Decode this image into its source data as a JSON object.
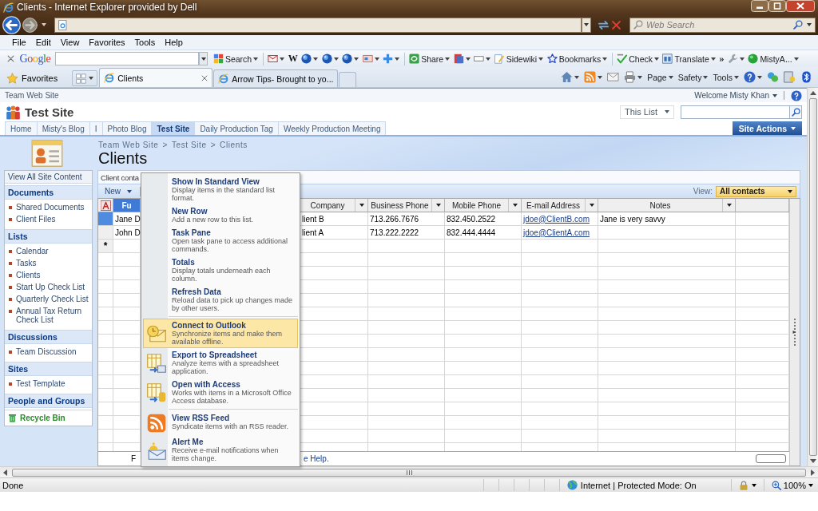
{
  "window": {
    "title": "Clients - Internet Explorer provided by Dell"
  },
  "address_bar": {
    "forward_disabled": true,
    "search_placeholder": "Web Search"
  },
  "menu_bar": [
    "File",
    "Edit",
    "View",
    "Favorites",
    "Tools",
    "Help"
  ],
  "google_toolbar": {
    "logo": "Google",
    "items": [
      {
        "kind": "search",
        "label": "Search",
        "dropdown": true
      },
      {
        "kind": "separator"
      },
      {
        "kind": "mail",
        "dropdown": true
      },
      {
        "kind": "text",
        "label": "W",
        "dropdown": false
      },
      {
        "kind": "globe",
        "dropdown": true
      },
      {
        "kind": "globe",
        "dropdown": true
      },
      {
        "kind": "globe",
        "dropdown": true
      },
      {
        "kind": "card",
        "dropdown": true
      },
      {
        "kind": "plus",
        "dropdown": true
      },
      {
        "kind": "separator"
      },
      {
        "kind": "share",
        "label": "Share",
        "dropdown": true
      },
      {
        "kind": "pdf",
        "dropdown": true
      },
      {
        "kind": "frame",
        "dropdown": true
      },
      {
        "kind": "sidewiki",
        "label": "Sidewiki",
        "dropdown": true
      },
      {
        "kind": "star",
        "label": "Bookmarks",
        "dropdown": true
      },
      {
        "kind": "separator"
      },
      {
        "kind": "spell",
        "label": "Check",
        "dropdown": true
      },
      {
        "kind": "translate",
        "label": "Translate",
        "dropdown": true
      },
      {
        "kind": "text",
        "label": "»",
        "dropdown": false
      },
      {
        "kind": "wrench",
        "dropdown": true
      },
      {
        "kind": "status",
        "label": "MistyA...",
        "dropdown": true
      }
    ]
  },
  "tabs_bar": {
    "favorites": "Favorites",
    "tabs": [
      {
        "title": "Clients",
        "selected": true
      },
      {
        "title": "Arrow Tips- Brought to yo...",
        "selected": false
      }
    ],
    "commands": [
      {
        "kind": "home",
        "dropdown": true
      },
      {
        "kind": "feed",
        "dropdown": true
      },
      {
        "kind": "readmail",
        "dropdown": false
      },
      {
        "kind": "print",
        "dropdown": true
      },
      {
        "kind": "text",
        "label": "Page",
        "dropdown": true
      },
      {
        "kind": "text",
        "label": "Safety",
        "dropdown": true
      },
      {
        "kind": "text",
        "label": "Tools",
        "dropdown": true
      },
      {
        "kind": "help",
        "dropdown": true
      },
      {
        "kind": "messenger",
        "dropdown": false
      },
      {
        "kind": "research",
        "dropdown": false
      },
      {
        "kind": "bluetooth",
        "dropdown": false
      }
    ]
  },
  "site": {
    "top_link": "Team Web Site",
    "welcome": "Welcome Misty Khan",
    "title": "Test Site",
    "search_scope": "This List",
    "nav_tabs": [
      {
        "label": "Home",
        "selected": false
      },
      {
        "label": "Misty's Blog",
        "selected": false
      },
      {
        "label": "I",
        "selected": false
      },
      {
        "label": "Photo Blog",
        "selected": false
      },
      {
        "label": "Test Site",
        "selected": true
      },
      {
        "label": "Daily Production Tag",
        "selected": false
      },
      {
        "label": "Weekly Production Meeting",
        "selected": false
      }
    ],
    "site_actions": "Site Actions",
    "breadcrumb": {
      "separator": ">",
      "items": [
        "Team Web Site",
        "Test Site",
        "Clients"
      ]
    },
    "page_title": "Clients"
  },
  "sidebar": {
    "view_all": "View All Site Content",
    "sections": [
      {
        "heading": "Documents",
        "items": [
          "Shared Documents",
          "Client Files"
        ]
      },
      {
        "heading": "Lists",
        "items": [
          "Calendar",
          "Tasks",
          "Clients",
          "Start Up Check List",
          "Quarterly Check List",
          "Annual Tax Return Check List"
        ]
      },
      {
        "heading": "Discussions",
        "items": [
          "Team Discussion"
        ]
      },
      {
        "heading": "Sites",
        "items": [
          "Test Template"
        ]
      },
      {
        "heading": "People and Groups"
      }
    ],
    "recycle_bin": "Recycle Bin"
  },
  "list": {
    "description": "Client conta",
    "new_button": "New",
    "view_label": "View:",
    "view": "All contacts",
    "datasheet": {
      "columns": [
        {
          "label": "Fu",
          "kind": "text",
          "dropdown": false,
          "selected": true
        },
        {
          "label": "Company",
          "kind": "text",
          "dropdown": true,
          "selected": false
        },
        {
          "label": "Business Phone",
          "kind": "text",
          "dropdown": true,
          "selected": false
        },
        {
          "label": "Mobile Phone",
          "kind": "text",
          "dropdown": true,
          "selected": false
        },
        {
          "label": "E-mail Address",
          "kind": "link",
          "dropdown": true,
          "selected": false
        },
        {
          "label": "Notes",
          "kind": "text",
          "dropdown": true,
          "selected": false
        }
      ],
      "rows": [
        {
          "selected": true,
          "cells": [
            "Jane D",
            "lient B",
            "713.266.7676",
            "832.450.2522",
            "jdoe@ClientB.com",
            "Jane is very savvy"
          ]
        },
        {
          "selected": false,
          "cells": [
            "John D",
            "lient A",
            "713.222.2222",
            "832.444.4444",
            "jdoe@ClientA.com"
          ]
        }
      ],
      "new_row_marker": "*",
      "status": [
        "F",
        "e Help."
      ]
    }
  },
  "context_menu": {
    "groups": [
      {
        "items": [
          {
            "kind": "plain",
            "title": "Show In Standard View",
            "description": "Display items in the standard list format.",
            "selected": false
          },
          {
            "kind": "plain",
            "title": "New Row",
            "description": "Add a new row to this list.",
            "selected": false
          },
          {
            "kind": "plain",
            "title": "Task Pane",
            "description": "Open task pane to access additional commands.",
            "selected": false
          },
          {
            "kind": "plain",
            "title": "Totals",
            "description": "Display totals underneath each column.",
            "selected": false
          },
          {
            "kind": "plain",
            "title": "Refresh Data",
            "description": "Reload data to pick up changes made by other users.",
            "selected": false
          }
        ]
      },
      {
        "items": [
          {
            "kind": "outlook",
            "title": "Connect to Outlook",
            "description": "Synchronize items and make them available offline.",
            "selected": true
          },
          {
            "kind": "export",
            "title": "Export to Spreadsheet",
            "description": "Analyze items with a spreadsheet application.",
            "selected": false
          },
          {
            "kind": "access",
            "title": "Open with Access",
            "description": "Works with items in a Microsoft Office Access database.",
            "selected": false
          }
        ]
      },
      {
        "items": [
          {
            "kind": "rss",
            "title": "View RSS Feed",
            "description": "Syndicate items with an RSS reader.",
            "selected": false
          },
          {
            "kind": "alert",
            "title": "Alert Me",
            "description": "Receive e-mail notifications when items change.",
            "selected": false
          }
        ]
      }
    ]
  },
  "status_bar": {
    "text": "Done",
    "zone": "Internet | Protected Mode: On",
    "zoom": "100%"
  }
}
